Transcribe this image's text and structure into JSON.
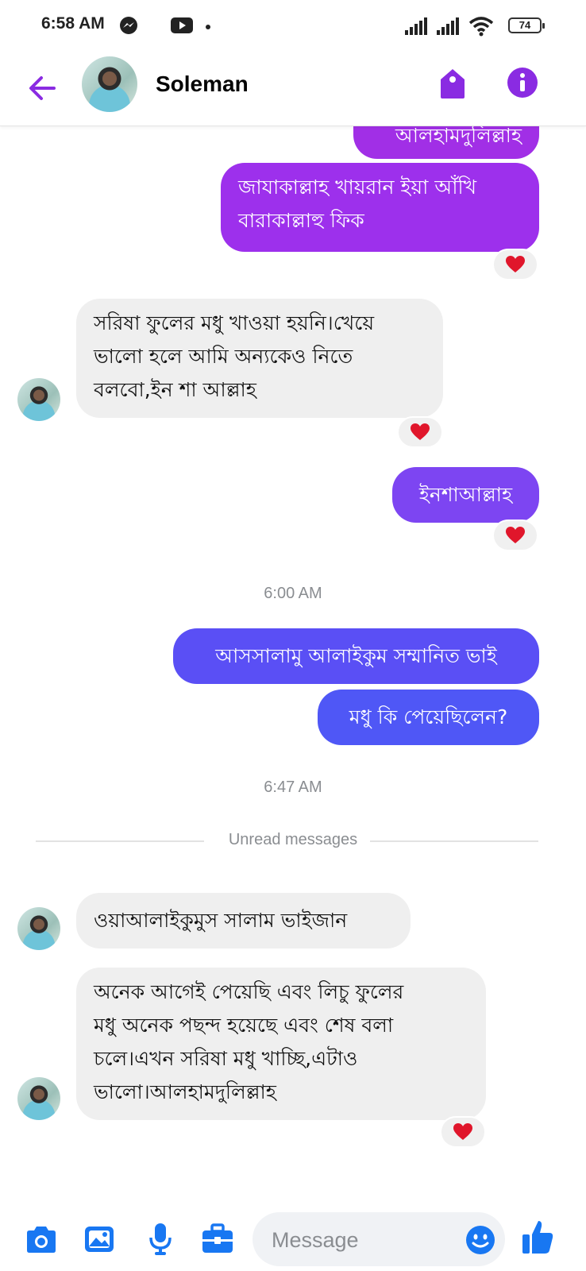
{
  "status_bar": {
    "time": "6:58 AM",
    "battery": "74",
    "icons": [
      "messenger-icon",
      "youtube-icon",
      "signal-icon",
      "signal-icon",
      "wifi-icon"
    ]
  },
  "header": {
    "contact_name": "Soleman",
    "icons": [
      "back-arrow-icon",
      "tag-icon",
      "info-icon"
    ]
  },
  "colors": {
    "accent": "#8a2be2",
    "bubble_purple": "#9333ea",
    "bubble_blue": "#5b4ef5",
    "incoming_bg": "#efefef",
    "heart": "#e0162b"
  },
  "messages": [
    {
      "direction": "out",
      "text": "আলহামদুলিল্লাহ",
      "reaction": ""
    },
    {
      "direction": "out",
      "lines": [
        "জাযাকাল্লাহ খায়রান ইয়া আঁখি",
        "বারাকাল্লাহু ফিক"
      ],
      "reaction": "heart"
    },
    {
      "direction": "in",
      "lines": [
        "সরিষা ফুলের মধু খাওয়া হয়নি।খেয়ে",
        "ভালো হলে আমি অন্যকেও নিতে",
        "বলবো,ইন শা আল্লাহ"
      ],
      "reaction": "heart"
    },
    {
      "direction": "out",
      "text": "ইনশাআল্লাহ",
      "reaction": "heart"
    },
    {
      "direction": "out",
      "text": "আসসালামু আলাইকুম সম্মানিত ভাই",
      "reaction": ""
    },
    {
      "direction": "out",
      "text": "মধু কি পেয়েছিলেন?",
      "reaction": ""
    },
    {
      "direction": "in",
      "text": "ওয়াআলাইকুমুস সালাম ভাইজান",
      "reaction": ""
    },
    {
      "direction": "in",
      "lines": [
        "অনেক আগেই পেয়েছি এবং লিচু ফুলের",
        "মধু অনেক পছন্দ হয়েছে এবং শেষ বলা",
        "চলে।এখন সরিষা মধু খাচ্ছি,এটাও",
        "ভালো।আলহামদুলিল্লাহ"
      ],
      "reaction": "heart"
    }
  ],
  "timestamps": [
    "6:00 AM",
    "6:47 AM"
  ],
  "unread_divider": "Unread messages",
  "composer": {
    "placeholder": "Message",
    "icons": [
      "camera-icon",
      "gallery-icon",
      "microphone-icon",
      "toolbox-icon",
      "emoji-icon",
      "thumbs-up-icon"
    ]
  }
}
